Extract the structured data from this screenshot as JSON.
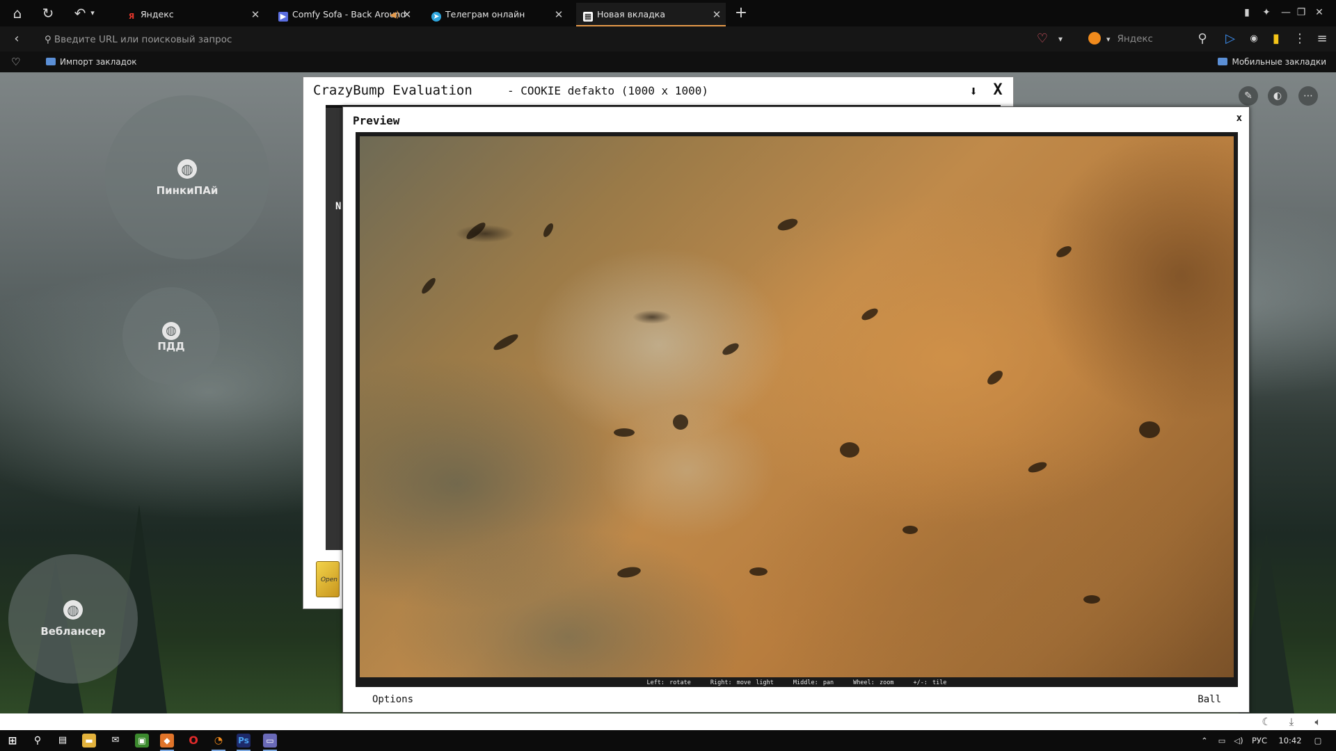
{
  "browser": {
    "tabs": [
      {
        "label": "Яндекс",
        "favicon": "yandex-icon",
        "color": "#e8372c"
      },
      {
        "label": "Comfy Sofa - Back Around",
        "favicon": "video-icon",
        "color": "#5a6de0"
      },
      {
        "label": "Телеграм онлайн",
        "favicon": "telegram-icon",
        "color": "#2ea6de"
      },
      {
        "label": "Новая вкладка",
        "favicon": "newtab-icon",
        "color": "#ffffff"
      }
    ],
    "active_tab_index": 3,
    "address": {
      "placeholder": "Введите URL или поисковый запрос"
    },
    "search_engine": "Яндекс",
    "bookmarks": {
      "import_label": "Импорт закладок",
      "mobile_label": "Мобильные закладки"
    },
    "accent_color": "#e69a4a"
  },
  "new_tab": {
    "speed_dials": [
      {
        "label": "ПинкиПАй",
        "icon": "globe-icon"
      },
      {
        "label": "ПДД",
        "icon": "globe-icon"
      },
      {
        "label": "Веблансер",
        "icon": "globe-icon"
      }
    ]
  },
  "crazybump": {
    "title": "CrazyBump Evaluation",
    "subtitle": "- COOKIE defakto (1000 x 1000)",
    "close_label": "X",
    "panel_letter": "N",
    "open_label": "Open",
    "preview": {
      "title": "Preview",
      "close_label": "x",
      "hints": [
        "Left: rotate",
        "Right: move light",
        "Middle: pan",
        "Wheel: zoom",
        "+/-: tile"
      ],
      "options_label": "Options",
      "shape_label": "Ball"
    }
  },
  "taskbar": {
    "language": "РУС",
    "time": "10:42"
  }
}
